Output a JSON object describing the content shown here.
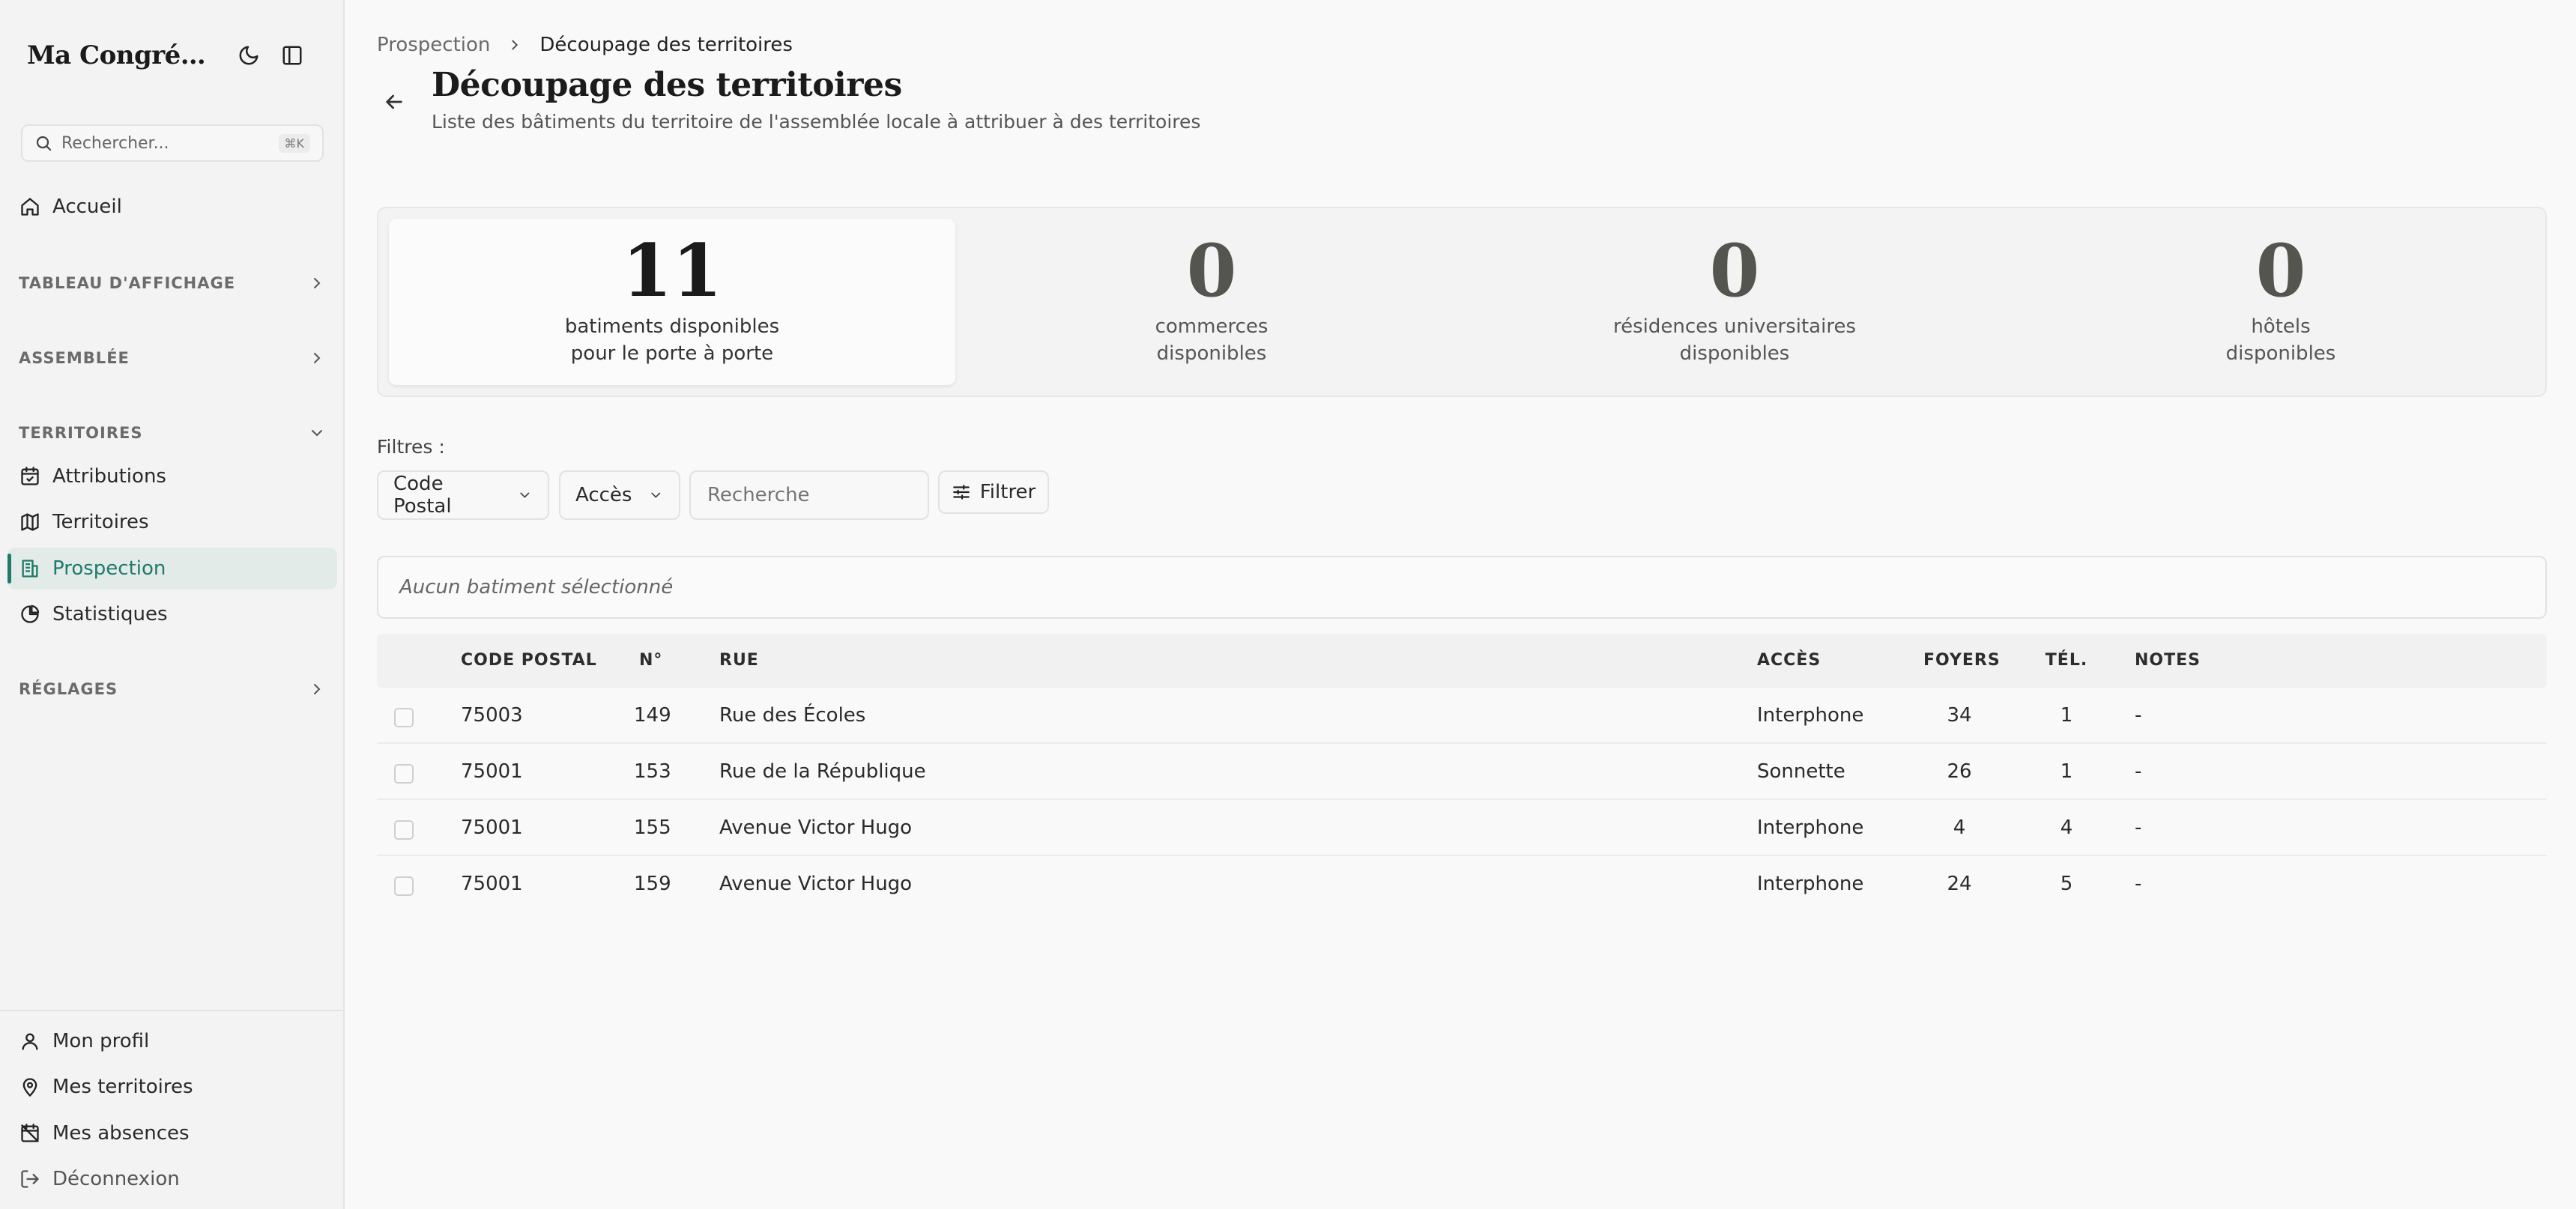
{
  "sidebar": {
    "brand": "Ma Congrégat...",
    "search": {
      "placeholder": "Rechercher...",
      "shortcut": "⌘K"
    },
    "home": "Accueil",
    "sections": {
      "board": "TABLEAU D'AFFICHAGE",
      "assembly": "ASSEMBLÉE",
      "territories": "TERRITOIRES",
      "settings": "RÉGLAGES"
    },
    "territory_items": [
      {
        "label": "Attributions",
        "icon": "calendar-check-icon"
      },
      {
        "label": "Territoires",
        "icon": "map-icon"
      },
      {
        "label": "Prospection",
        "icon": "building-icon",
        "active": true
      },
      {
        "label": "Statistiques",
        "icon": "pie-chart-icon"
      }
    ],
    "footer_items": [
      {
        "label": "Mon profil",
        "icon": "user-icon"
      },
      {
        "label": "Mes territoires",
        "icon": "map-pin-icon"
      },
      {
        "label": "Mes absences",
        "icon": "calendar-off-icon"
      },
      {
        "label": "Déconnexion",
        "icon": "logout-icon"
      }
    ]
  },
  "breadcrumb": {
    "parent": "Prospection",
    "current": "Découpage des territoires"
  },
  "page": {
    "title": "Découpage des territoires",
    "subtitle": "Liste des bâtiments du territoire de l'assemblée locale à attribuer à des territoires"
  },
  "stats": [
    {
      "value": "11",
      "line1": "batiments disponibles",
      "line2": "pour le porte à porte"
    },
    {
      "value": "0",
      "line1": "commerces",
      "line2": "disponibles"
    },
    {
      "value": "0",
      "line1": "résidences universitaires",
      "line2": "disponibles"
    },
    {
      "value": "0",
      "line1": "hôtels",
      "line2": "disponibles"
    }
  ],
  "filters": {
    "label": "Filtres :",
    "postal_code": "Code Postal",
    "access": "Accès",
    "search_placeholder": "Recherche",
    "filter_button": "Filtrer"
  },
  "selection_empty": "Aucun batiment sélectionné",
  "table": {
    "headers": {
      "postal_code": "CODE POSTAL",
      "number": "N°",
      "street": "RUE",
      "access": "ACCÈS",
      "households": "FOYERS",
      "phone": "TÉL.",
      "notes": "NOTES"
    },
    "rows": [
      {
        "postal_code": "75003",
        "number": "149",
        "street": "Rue des Écoles",
        "access": "Interphone",
        "households": "34",
        "phone": "1",
        "notes": "-"
      },
      {
        "postal_code": "75001",
        "number": "153",
        "street": "Rue de la République",
        "access": "Sonnette",
        "households": "26",
        "phone": "1",
        "notes": "-"
      },
      {
        "postal_code": "75001",
        "number": "155",
        "street": "Avenue Victor Hugo",
        "access": "Interphone",
        "households": "4",
        "phone": "4",
        "notes": "-"
      },
      {
        "postal_code": "75001",
        "number": "159",
        "street": "Avenue Victor Hugo",
        "access": "Interphone",
        "households": "24",
        "phone": "5",
        "notes": "-"
      }
    ]
  },
  "colors": {
    "accent": "#1f7a69",
    "active_bg": "#e3ebe9"
  }
}
